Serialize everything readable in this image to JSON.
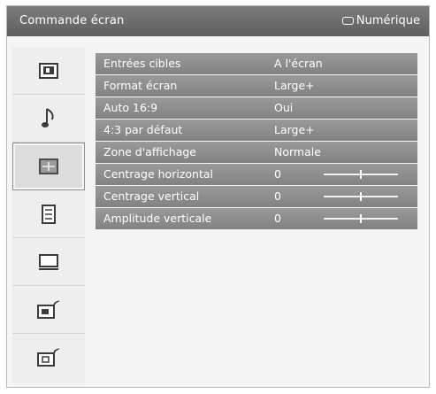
{
  "header": {
    "title": "Commande écran",
    "source_label": "Numérique",
    "source_icon": "tv-screen-icon"
  },
  "sidebar": {
    "items": [
      {
        "icon": "picture-icon",
        "active": false
      },
      {
        "icon": "music-note-icon",
        "active": false
      },
      {
        "icon": "screen-control-icon",
        "active": true
      },
      {
        "icon": "settings-list-icon",
        "active": false
      },
      {
        "icon": "monitor-icon",
        "active": false
      },
      {
        "icon": "digital-setup-icon",
        "active": false
      },
      {
        "icon": "digital-tuning-icon",
        "active": false
      }
    ]
  },
  "menu": {
    "rows": [
      {
        "label": "Entrées cibles",
        "value": "A l'écran"
      },
      {
        "label": "Format écran",
        "value": "Large+"
      },
      {
        "label": "Auto 16:9",
        "value": "Oui"
      },
      {
        "label": "4:3 par défaut",
        "value": "Large+"
      },
      {
        "label": "Zone d'affichage",
        "value": "Normale"
      },
      {
        "label": "Centrage horizontal",
        "value": "0",
        "slider": 0.5
      },
      {
        "label": "Centrage vertical",
        "value": "0",
        "slider": 0.5
      },
      {
        "label": "Amplitude verticale",
        "value": "0",
        "slider": 0.5
      }
    ]
  },
  "colors": {
    "header_bg": "#6e6e6e",
    "row_bg": "#8e8e8e",
    "text": "#ffffff"
  }
}
